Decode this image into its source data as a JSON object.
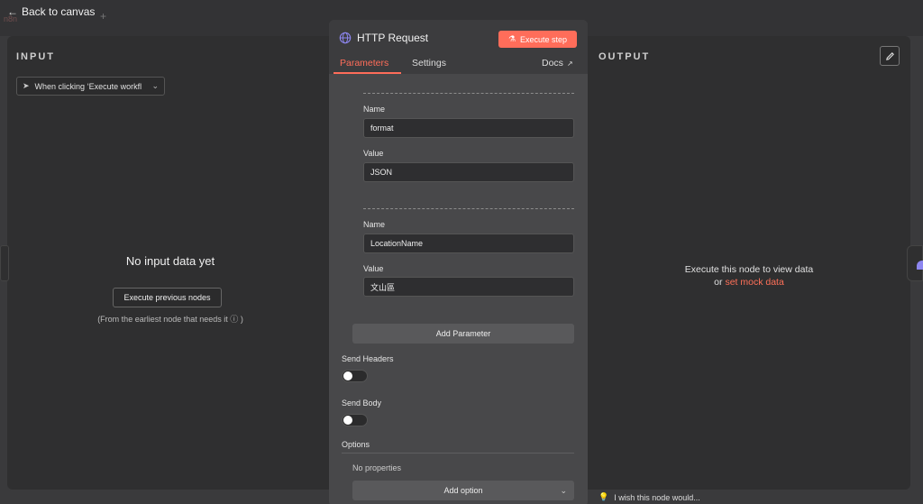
{
  "topbar": {
    "back_label": "Back to canvas",
    "back_icon": "arrow-left-icon"
  },
  "input_panel": {
    "heading": "INPUT",
    "trigger_select": "When clicking ‘Execute workfl",
    "empty_title": "No input data yet",
    "execute_previous_label": "Execute previous nodes",
    "earliest_note": "(From the earliest node that needs it"
  },
  "node": {
    "title": "HTTP Request",
    "execute_step_label": "Execute step",
    "tabs": [
      {
        "label": "Parameters",
        "active": true
      },
      {
        "label": "Settings",
        "active": false
      }
    ],
    "docs_label": "Docs",
    "parameters": [
      {
        "name_label": "Name",
        "name_value": "format",
        "value_label": "Value",
        "value_value": "JSON"
      },
      {
        "name_label": "Name",
        "name_value": "LocationName",
        "value_label": "Value",
        "value_value": "文山區"
      }
    ],
    "add_parameter_label": "Add Parameter",
    "send_headers_label": "Send Headers",
    "send_headers_on": false,
    "send_body_label": "Send Body",
    "send_body_on": false,
    "options_label": "Options",
    "no_properties_label": "No properties",
    "add_option_label": "Add option",
    "accent_color": "#ff6d5a"
  },
  "output_panel": {
    "heading": "OUTPUT",
    "empty_line1": "Execute this node to view data",
    "empty_or": "or",
    "mock_link": "set mock data"
  },
  "feedback": {
    "wish_label": "I wish this node would..."
  }
}
